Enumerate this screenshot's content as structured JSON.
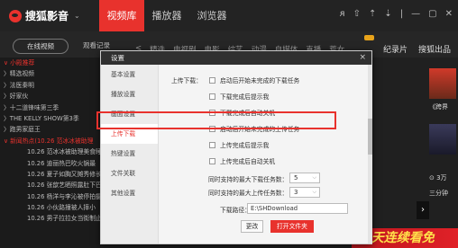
{
  "app": {
    "name": "搜狐影音",
    "tabs": [
      "视频库",
      "播放器",
      "浏览器"
    ],
    "active_tab": 0,
    "window_icons": [
      "user-icon",
      "shirt-icon",
      "upload-icon",
      "download-icon",
      "minimize-icon",
      "maximize-icon",
      "close-icon"
    ]
  },
  "subnav": {
    "online_button": "在线视频",
    "watch_record": "观看记录",
    "categories": [
      "<",
      "精选",
      "电视剧",
      "电影",
      "综艺",
      "动漫",
      "自媒体",
      "直播",
      "荒女"
    ],
    "right_links": [
      "纪录片",
      "搜狐出品"
    ]
  },
  "left_list": [
    {
      "label": "∨ 小殿推荐",
      "red": true,
      "sub": false
    },
    {
      "label": "〉精选视频",
      "red": false,
      "sub": false
    },
    {
      "label": "〉法医秦明",
      "red": false,
      "sub": false
    },
    {
      "label": "〉好家伙",
      "red": false,
      "sub": false
    },
    {
      "label": "〉十二道锋味第三季",
      "red": false,
      "sub": false
    },
    {
      "label": "〉THE KELLY SHOW第3季",
      "red": false,
      "sub": false
    },
    {
      "label": "〉跑男家庭王",
      "red": false,
      "sub": false
    },
    {
      "label": "∨ 新闻热点(10.26 范冰冰被助理",
      "red": true,
      "sub": false
    },
    {
      "label": "10.26 范冰冰被助理美食睡",
      "red": false,
      "sub": false
    },
    {
      "label": "10.26 迪丽热巴吹火锅最",
      "red": false,
      "sub": false
    },
    {
      "label": "10.26 夏子如胸又摊秀修长",
      "red": false,
      "sub": false
    },
    {
      "label": "10.26 张歆艺晒照露肚下巴",
      "red": false,
      "sub": false
    },
    {
      "label": "10.26 杨洋与李沁被停拍摄",
      "red": false,
      "sub": false
    },
    {
      "label": "10.26 小伙路撞被人摔小",
      "red": false,
      "sub": false
    },
    {
      "label": "10.26 男子拉拉女当街制止",
      "red": false,
      "sub": false
    }
  ],
  "thumbs": {
    "captions": [
      "《跨界",
      "⊙ 3万",
      "三分钟"
    ]
  },
  "promo": {
    "text": "3天连续看免"
  },
  "dialog": {
    "title": "设置",
    "close": "×",
    "sidebar": [
      "基本设置",
      "播放设置",
      "画面设置",
      "上传下载",
      "热键设置",
      "文件关联",
      "其他设置"
    ],
    "active_sidebar": 3,
    "upload_label": "上传下载：",
    "checkboxes": [
      "启动后开始未完成的下载任务",
      "下载完成后提示我",
      "下载完成后自动关机",
      "启动后开始未完成的上传任务",
      "上传完成后提示我",
      "上传完成后自动关机"
    ],
    "max_download_label": "同时支持的最大下载任务数：",
    "max_download_value": "5",
    "max_upload_label": "同时支持的最大上传任务数：",
    "max_upload_value": "3",
    "path_label": "下载路径：",
    "path_value": "E:\\SHDownload",
    "change_button": "更改",
    "open_folder_button": "打开文件夹"
  },
  "colors": {
    "accent": "#e8322d",
    "topbar": "#232323",
    "dialog_bg": "#f4f4f4"
  }
}
